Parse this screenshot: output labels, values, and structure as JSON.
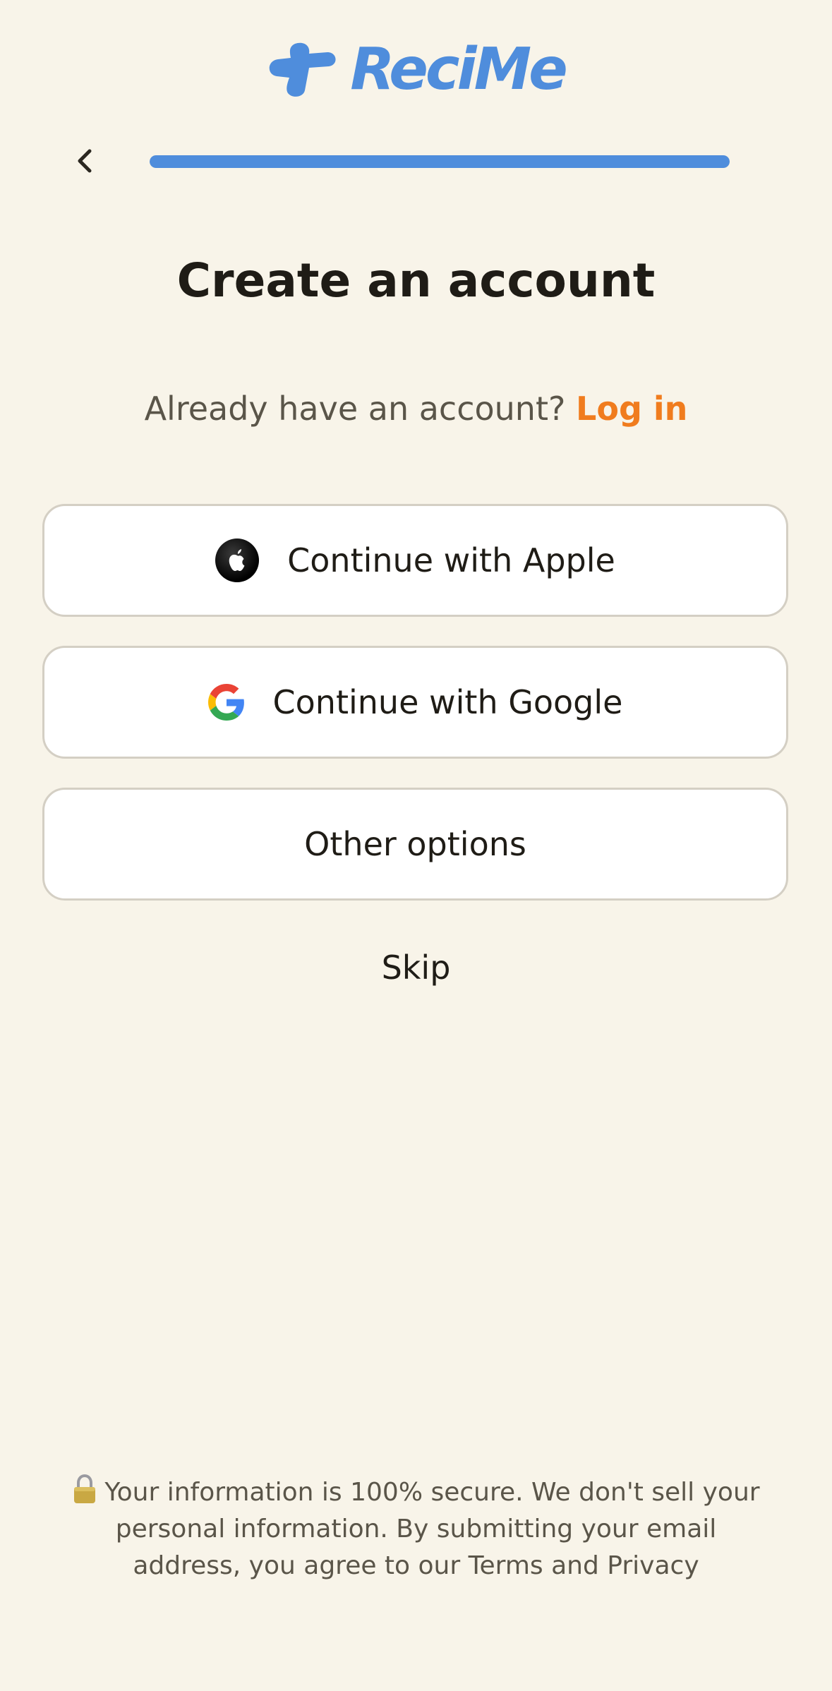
{
  "app": {
    "name": "ReciMe",
    "brand_color": "#4f8ddc",
    "accent_color": "#f07c1e",
    "background_color": "#f8f4e9"
  },
  "nav": {
    "back_icon": "chevron-left-icon",
    "progress_percent": 100
  },
  "header": {
    "title": "Create an account"
  },
  "login": {
    "prompt": "Already have an account?",
    "link": "Log in"
  },
  "auth_buttons": {
    "apple": {
      "label": "Continue with Apple",
      "icon": "apple-icon"
    },
    "google": {
      "label": "Continue with Google",
      "icon": "google-icon"
    },
    "other": {
      "label": "Other options"
    }
  },
  "skip": {
    "label": "Skip"
  },
  "disclaimer": {
    "icon": "lock-icon",
    "text": "Your information is 100% secure. We don't sell your personal information. By submitting your email address, you agree to our",
    "terms": "Terms",
    "and": "and",
    "privacy": "Privacy"
  }
}
